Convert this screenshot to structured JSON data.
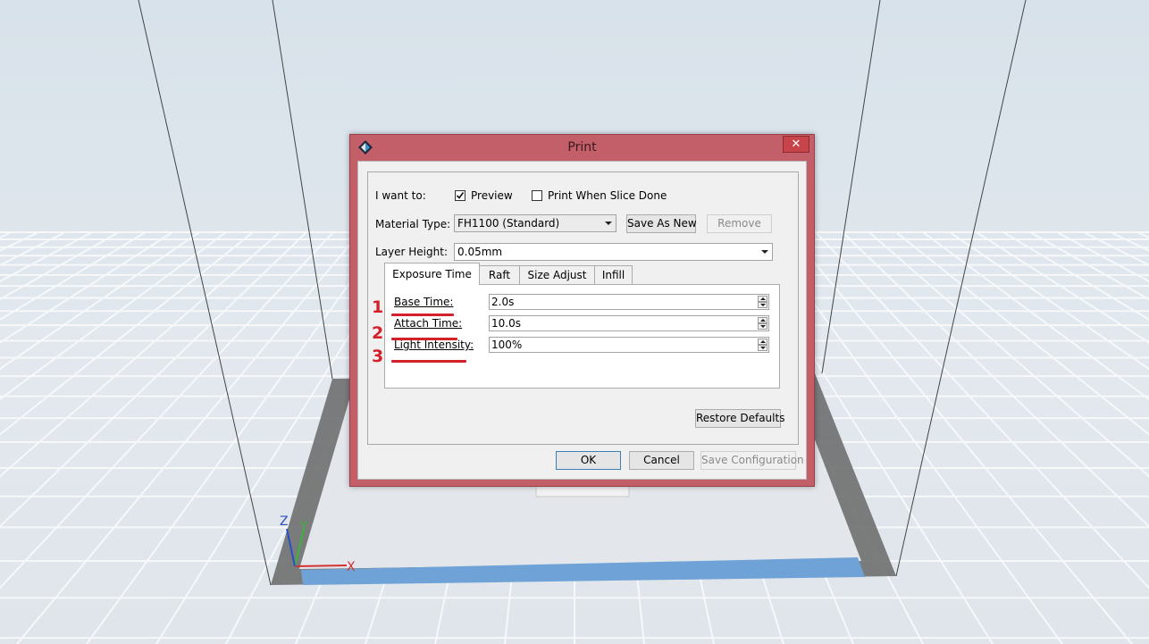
{
  "dialog": {
    "title": "Print",
    "close_glyph": "✕"
  },
  "form": {
    "i_want_to_label": "I want to:",
    "preview_label": "Preview",
    "preview_checked": true,
    "print_when_done_label": "Print When Slice Done",
    "print_when_done_checked": false,
    "material_type_label": "Material Type:",
    "material_type_value": "FH1100 (Standard)",
    "save_as_new_label": "Save As New",
    "remove_label": "Remove",
    "layer_height_label": "Layer Height:",
    "layer_height_value": "0.05mm"
  },
  "tabs": [
    {
      "label": "Exposure Time",
      "active": true
    },
    {
      "label": "Raft",
      "active": false
    },
    {
      "label": "Size Adjust",
      "active": false
    },
    {
      "label": "Infill",
      "active": false
    }
  ],
  "exposure": {
    "fields": [
      {
        "marker": "1",
        "label": "Base Time:",
        "value": "2.0s"
      },
      {
        "marker": "2",
        "label": "Attach Time:",
        "value": "10.0s"
      },
      {
        "marker": "3",
        "label": "Light Intensity:",
        "value": "100%"
      }
    ],
    "restore_defaults_label": "Restore Defaults"
  },
  "footer": {
    "ok_label": "OK",
    "cancel_label": "Cancel",
    "save_configuration_label": "Save Configuration"
  },
  "axes": {
    "x": "X",
    "y": "Y",
    "z": "Z"
  },
  "colors": {
    "dialog_frame": "#c25f69",
    "annotation_red": "#d4202a",
    "build_plate_blue": "#6fa3d8",
    "axis_x": "#d23232",
    "axis_y": "#3cb43c",
    "axis_z": "#2850c8"
  },
  "icons": {
    "app": "app-logo-icon",
    "close": "close-icon",
    "checkmark": "checkmark-icon",
    "dropdown": "chevron-down-icon",
    "spinner": "spinner-arrows-icon"
  }
}
